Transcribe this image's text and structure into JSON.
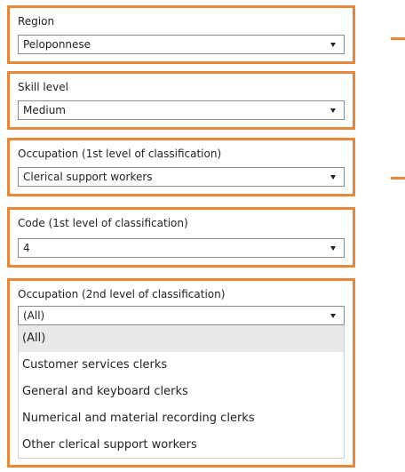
{
  "filters": {
    "region": {
      "label": "Region",
      "value": "Peloponnese"
    },
    "skill_level": {
      "label": "Skill level",
      "value": "Medium"
    },
    "occupation_level1": {
      "label": "Occupation (1st level of classification)",
      "value": "Clerical support workers"
    },
    "code_level1": {
      "label": "Code (1st level of classification)",
      "value": "4"
    },
    "occupation_level2": {
      "label": "Occupation (2nd level of classification)",
      "value": "(All)",
      "options": [
        "(All)",
        "Customer services clerks",
        "General and keyboard clerks",
        "Numerical and material recording clerks",
        "Other clerical support workers"
      ]
    }
  },
  "colors": {
    "highlight_border": "#e8873a",
    "selected_option_bg": "#e9e9e9"
  },
  "icons": {
    "dropdown": "chevron-down-icon"
  }
}
